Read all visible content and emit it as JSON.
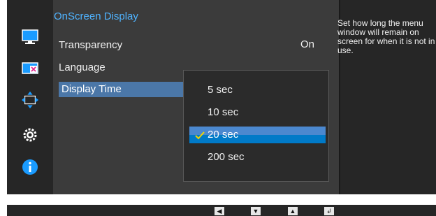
{
  "menu": {
    "title": "OnScreen Display",
    "items": [
      {
        "label": "Transparency",
        "value": "On"
      },
      {
        "label": "Language"
      },
      {
        "label": "Display Time",
        "selected": true
      }
    ]
  },
  "popup": {
    "options": [
      {
        "label": "5 sec"
      },
      {
        "label": "10 sec"
      },
      {
        "label": "20 sec",
        "selected": true
      },
      {
        "label": "200 sec"
      }
    ]
  },
  "help": {
    "text": "Set how long the menu window will remain on screen for when it is not in use."
  },
  "sidebar": {
    "icons": [
      "monitor-icon",
      "picture-in-picture-icon",
      "resize-arrows-icon",
      "gear-icon",
      "info-icon"
    ]
  },
  "bottom_keys": [
    {
      "icon": "left-arrow-icon",
      "glyph": "◀"
    },
    {
      "icon": "down-arrow-icon",
      "glyph": "▼"
    },
    {
      "icon": "up-arrow-icon",
      "glyph": "▲"
    },
    {
      "icon": "enter-icon",
      "glyph": "↲"
    }
  ],
  "colors": {
    "accent_blue": "#4fb3ff",
    "selection_blue": "#007ac8",
    "menu_selection": "#4b77a8",
    "check_yellow": "#f2d600"
  }
}
